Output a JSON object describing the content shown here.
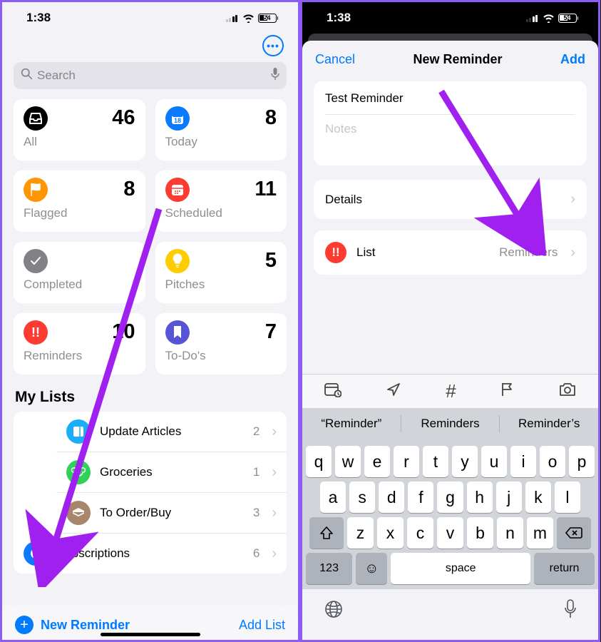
{
  "status": {
    "time": "1:38",
    "battery": "54"
  },
  "left": {
    "search_placeholder": "Search",
    "tiles": [
      {
        "label": "All",
        "count": "46",
        "color": "#000000",
        "icon": "tray"
      },
      {
        "label": "Today",
        "count": "8",
        "color": "#0a7aff",
        "icon": "calendar"
      },
      {
        "label": "Flagged",
        "count": "8",
        "color": "#ff9500",
        "icon": "flag"
      },
      {
        "label": "Scheduled",
        "count": "11",
        "color": "#fd3b30",
        "icon": "calgrid"
      },
      {
        "label": "Completed",
        "count": "",
        "color": "#808286",
        "icon": "check"
      },
      {
        "label": "Pitches",
        "count": "5",
        "color": "#ffcc00",
        "icon": "bulb"
      },
      {
        "label": "Reminders",
        "count": "10",
        "color": "#fd3b30",
        "icon": "priority"
      },
      {
        "label": "To-Do's",
        "count": "7",
        "color": "#5755d5",
        "icon": "bookmark"
      }
    ],
    "mylists_header": "My Lists",
    "lists": [
      {
        "label": "Update Articles",
        "count": "2",
        "color": "#1badf8"
      },
      {
        "label": "Groceries",
        "count": "1",
        "color": "#30d158"
      },
      {
        "label": "To Order/Buy",
        "count": "3",
        "color": "#a8866b"
      },
      {
        "label": "Subscriptions",
        "count": "6",
        "color": "#0a7aff"
      }
    ],
    "new_reminder": "New Reminder",
    "add_list": "Add List"
  },
  "right": {
    "cancel": "Cancel",
    "title": "New Reminder",
    "add": "Add",
    "reminder_title": "Test Reminder",
    "notes_placeholder": "Notes",
    "details": "Details",
    "list_label": "List",
    "list_value": "Reminders",
    "suggestions": [
      "“Reminder”",
      "Reminders",
      "Reminder’s"
    ],
    "keys_r1": [
      "q",
      "w",
      "e",
      "r",
      "t",
      "y",
      "u",
      "i",
      "o",
      "p"
    ],
    "keys_r2": [
      "a",
      "s",
      "d",
      "f",
      "g",
      "h",
      "j",
      "k",
      "l"
    ],
    "keys_r3": [
      "z",
      "x",
      "c",
      "v",
      "b",
      "n",
      "m"
    ],
    "key_123": "123",
    "key_space": "space",
    "key_return": "return"
  }
}
